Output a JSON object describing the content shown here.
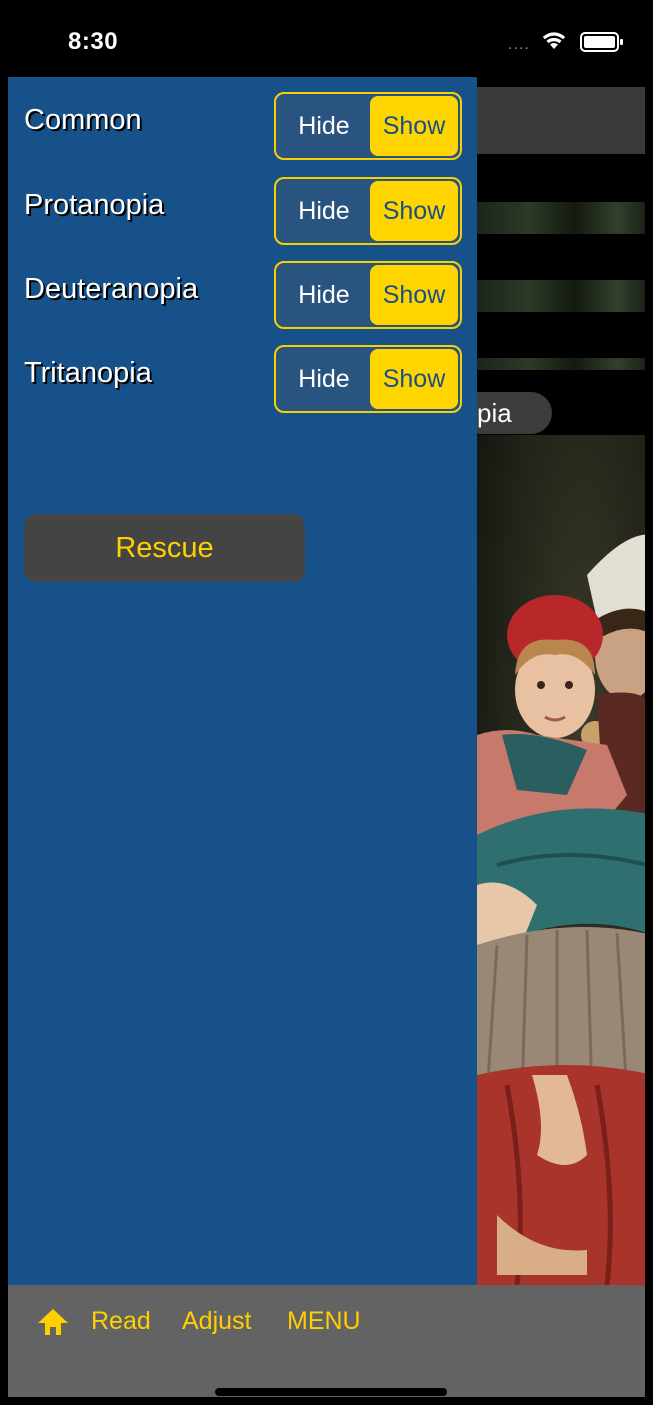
{
  "status_bar": {
    "time": "8:30",
    "signal": "....",
    "wifi_icon": "wifi-icon",
    "battery_icon": "battery-icon"
  },
  "background": {
    "pill_text": "pia",
    "image": "painting-mother-and-child"
  },
  "menu": {
    "rows": [
      {
        "label": "Common",
        "hide": "Hide",
        "show": "Show",
        "selected": "Show"
      },
      {
        "label": "Protanopia",
        "hide": "Hide",
        "show": "Show",
        "selected": "Show"
      },
      {
        "label": "Deuteranopia",
        "hide": "Hide",
        "show": "Show",
        "selected": "Show"
      },
      {
        "label": "Tritanopia",
        "hide": "Hide",
        "show": "Show",
        "selected": "Show"
      }
    ],
    "rescue_label": "Rescue"
  },
  "toolbar": {
    "home_icon": "home-icon",
    "read_label": "Read",
    "adjust_label": "Adjust",
    "menu_label": "MENU"
  },
  "colors": {
    "menu_bg": "#16518a",
    "accent": "#ffd500",
    "toolbar_bg": "#636363"
  }
}
